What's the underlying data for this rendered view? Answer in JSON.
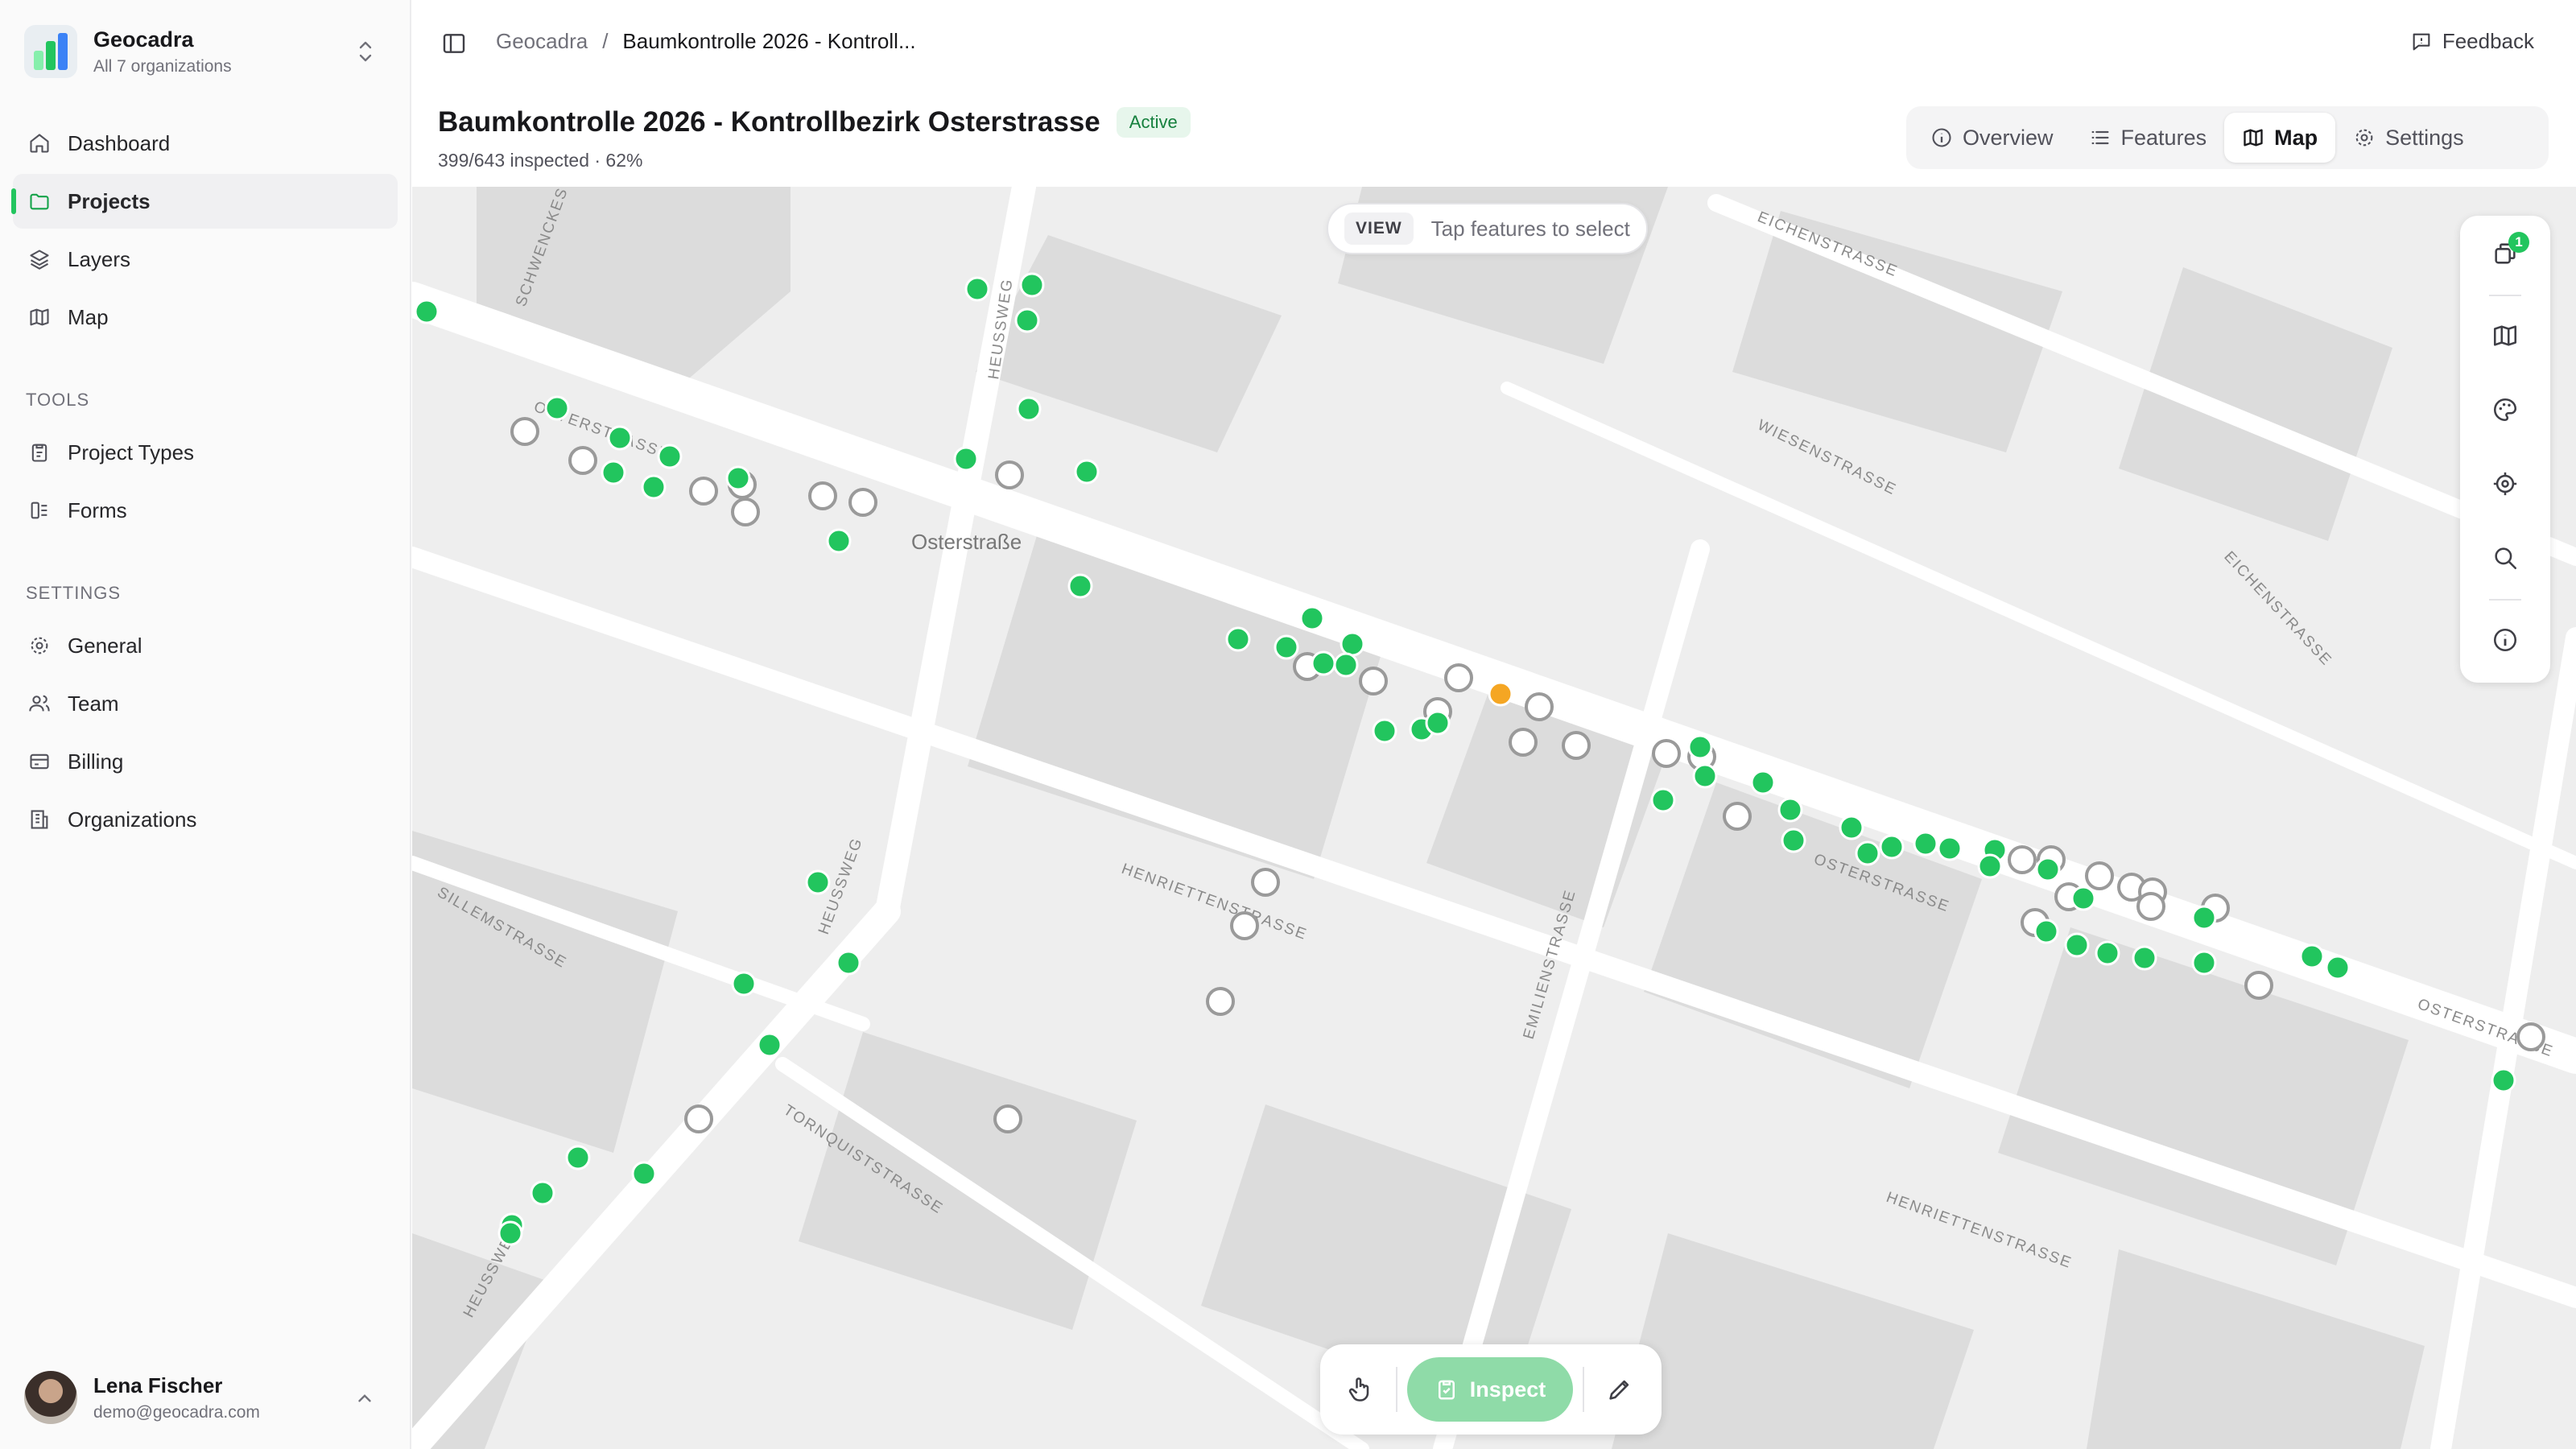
{
  "sidebar": {
    "org": {
      "name": "Geocadra",
      "subtitle": "All 7 organizations"
    },
    "nav": [
      {
        "label": "Dashboard",
        "icon": "home-icon"
      },
      {
        "label": "Projects",
        "icon": "folder-icon",
        "active": true
      },
      {
        "label": "Layers",
        "icon": "layers-icon"
      },
      {
        "label": "Map",
        "icon": "map-icon"
      }
    ],
    "tools_label": "TOOLS",
    "tools": [
      {
        "label": "Project Types",
        "icon": "clipboard-icon"
      },
      {
        "label": "Forms",
        "icon": "form-icon"
      }
    ],
    "settings_label": "SETTINGS",
    "settings": [
      {
        "label": "General",
        "icon": "gear-icon"
      },
      {
        "label": "Team",
        "icon": "users-icon"
      },
      {
        "label": "Billing",
        "icon": "credit-card-icon"
      },
      {
        "label": "Organizations",
        "icon": "building-icon"
      }
    ],
    "user": {
      "name": "Lena Fischer",
      "email": "demo@geocadra.com"
    }
  },
  "header": {
    "breadcrumb": [
      "Geocadra",
      "Baumkontrolle 2026 - Kontroll..."
    ],
    "feedback": "Feedback",
    "title": "Baumkontrolle 2026 - Kontrollbezirk Osterstrasse",
    "status": "Active",
    "progress": "399/643 inspected · 62%",
    "tabs": [
      {
        "label": "Overview",
        "icon": "info-icon"
      },
      {
        "label": "Features",
        "icon": "list-icon"
      },
      {
        "label": "Map",
        "icon": "map-icon",
        "active": true
      },
      {
        "label": "Settings",
        "icon": "gear-icon"
      }
    ]
  },
  "map": {
    "mode_tag": "VIEW",
    "mode_hint": "Tap features to select",
    "layer_count": "1",
    "street_labels": [
      "Osterstraße",
      "SCHWENCKESTRA",
      "OSTERSTRASSE",
      "HEUSSWEG",
      "EICHENSTRASSE",
      "WIESENSTRASSE",
      "HENRIETTENSTRASSE",
      "SILLEMSTRASSE",
      "EMILIENSTRASSE",
      "TORNQUISTSTRASSE"
    ],
    "colors": {
      "inspected": "#22c55e",
      "pending": "#ffffff",
      "selected": "#f5a623",
      "accent": "#22c55e"
    }
  },
  "toolbar": {
    "inspect_label": "Inspect"
  }
}
